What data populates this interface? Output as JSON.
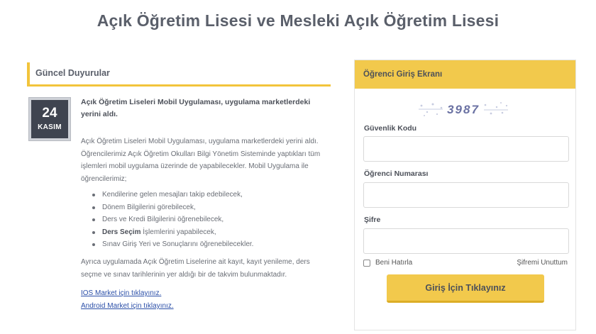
{
  "page": {
    "title": "Açık Öğretim Lisesi ve Mesleki Açık Öğretim Lisesi"
  },
  "announcements": {
    "header": "Güncel Duyurular",
    "date": {
      "day": "24",
      "month": "KASIM"
    },
    "title": "Açık Öğretim Liseleri Mobil Uygulaması, uygulama marketlerdeki yerini aldı.",
    "body": "Açık Öğretim Liseleri Mobil Uygulaması, uygulama marketlerdeki yerini aldı. Öğrencilerimiz Açık Öğretim Okulları Bilgi Yönetim Sisteminde yaptıkları tüm işlemleri mobil uygulama üzerinde de yapabilecekler. Mobil Uygulama ile öğrencilerimiz;",
    "items": [
      {
        "bold": "",
        "text": "Kendilerine gelen mesajları takip edebilecek,"
      },
      {
        "bold": "",
        "text": "Dönem Bilgilerini görebilecek,"
      },
      {
        "bold": "",
        "text": "Ders ve Kredi Bilgilerini öğrenebilecek,"
      },
      {
        "bold": "Ders Seçim",
        "text": " İşlemlerini yapabilecek,"
      },
      {
        "bold": "",
        "text": "Sınav Giriş Yeri ve Sonuçlarını öğrenebilecekler."
      }
    ],
    "body2": "Ayrıca uygulamada Açık Öğretim Liselerine ait kayıt, kayıt yenileme, ders seçme ve sınav tarihlerinin yer aldığı bir de takvim bulunmaktadır.",
    "ios_link": "IOS Market için tıklayınız.",
    "android_link": "Android Market için tıklayınız."
  },
  "login": {
    "header": "Öğrenci Giriş Ekranı",
    "captcha_text": "3987",
    "security_label": "Güvenlik Kodu",
    "security_value": "",
    "student_no_label": "Öğrenci Numarası",
    "student_no_value": "",
    "password_label": "Şifre",
    "password_value": "",
    "remember_label": "Beni Hatırla",
    "forgot_label": "Şifremi Unuttum",
    "submit_label": "Giriş İçin Tıklayınız"
  },
  "colors": {
    "accent": "#f2c94c",
    "badge_bg": "#3f4450",
    "link": "#2b4fa8"
  }
}
